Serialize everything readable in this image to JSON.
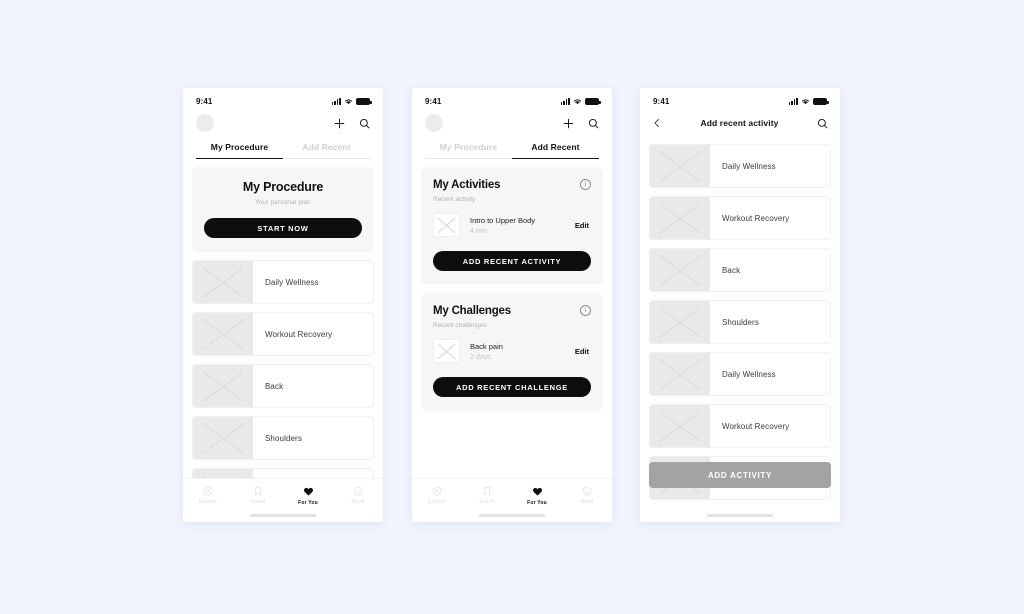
{
  "theme": {
    "page_background": "#f1f4fd",
    "card_background": "#f6f6f6",
    "accent_dark": "#0e0e0e",
    "accent_grey": "#a3a3a3",
    "muted_text": "#b3b3b3"
  },
  "status_bar": {
    "time": "9:41",
    "icons": [
      "signal-bars-icon",
      "wifi-icon",
      "battery-icon"
    ]
  },
  "screen1": {
    "name": "My Procedure",
    "top_nav": {
      "avatar": "avatar",
      "actions": [
        "plus-icon",
        "search-icon"
      ]
    },
    "tabs": [
      {
        "label": "My Procedure",
        "active": true
      },
      {
        "label": "Add Recent",
        "active": false
      }
    ],
    "hero": {
      "title": "My Procedure",
      "subtitle": "Your personal plan",
      "button": "START NOW"
    },
    "list": [
      {
        "label": "Daily Wellness"
      },
      {
        "label": "Workout Recovery"
      },
      {
        "label": "Back"
      },
      {
        "label": "Shoulders"
      }
    ],
    "tabbar": [
      {
        "label": "Explore",
        "icon": "compass-icon",
        "active": false
      },
      {
        "label": "Saved",
        "icon": "bookmark-icon",
        "active": false
      },
      {
        "label": "For You",
        "icon": "heart-icon",
        "active": true
      },
      {
        "label": "Mood",
        "icon": "smiley-icon",
        "active": false
      }
    ]
  },
  "screen2": {
    "name": "Add Recent",
    "top_nav": {
      "avatar": "avatar",
      "actions": [
        "plus-icon",
        "search-icon"
      ]
    },
    "tabs": [
      {
        "label": "My Procedure",
        "active": false
      },
      {
        "label": "Add Recent",
        "active": true
      }
    ],
    "activities": {
      "title": "My Activities",
      "subtitle": "Recent activity",
      "info_icon": "info-icon",
      "entry": {
        "title": "Intro to Upper Body",
        "meta": "4 min",
        "edit": "Edit"
      },
      "button": "ADD RECENT ACTIVITY"
    },
    "challenges": {
      "title": "My Challenges",
      "subtitle": "Recent challenges",
      "info_icon": "info-icon",
      "entry": {
        "title": "Back pain",
        "meta": "2 days",
        "edit": "Edit"
      },
      "button": "ADD RECENT CHALLENGE"
    },
    "tabbar": [
      {
        "label": "Explore",
        "icon": "compass-icon",
        "active": false
      },
      {
        "label": "Saved",
        "icon": "bookmark-icon",
        "active": false
      },
      {
        "label": "For You",
        "icon": "heart-icon",
        "active": true
      },
      {
        "label": "Mood",
        "icon": "smiley-icon",
        "active": false
      }
    ]
  },
  "screen3": {
    "name": "Add recent activity",
    "header": {
      "back_icon": "chevron-left-icon",
      "title": "Add recent activity",
      "search_icon": "search-icon"
    },
    "list": [
      {
        "label": "Daily Wellness"
      },
      {
        "label": "Workout Recovery"
      },
      {
        "label": "Back"
      },
      {
        "label": "Shoulders"
      },
      {
        "label": "Daily Wellness"
      },
      {
        "label": "Workout Recovery"
      }
    ],
    "button": "ADD ACTIVITY"
  }
}
